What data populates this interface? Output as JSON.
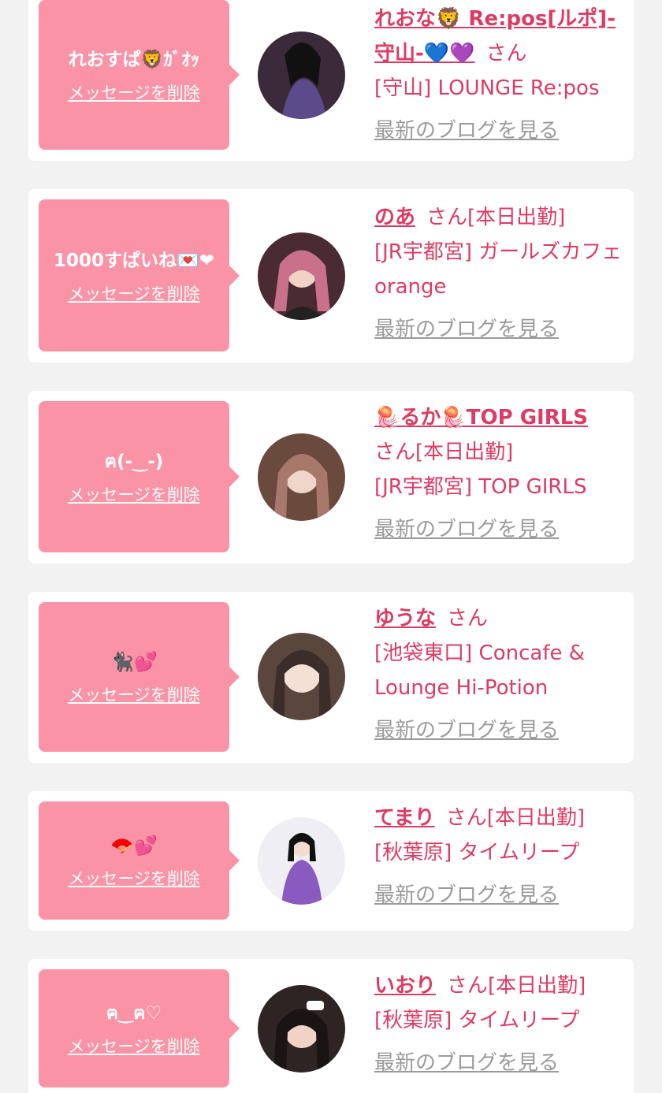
{
  "common": {
    "delete_label": "メッセージを削除",
    "blog_label": "最新のブログを見る",
    "san_suffix": "さん",
    "today_badge": "[本日出勤]"
  },
  "entries": [
    {
      "message": "れおすぱ🦁ｶﾞｵｯ",
      "name": "れおな🦁 Re:pos[ルポ]-守山-💙💜",
      "today": false,
      "shop": "[守山] LOUNGE Re:pos",
      "avatar_color": "#3a2a3a",
      "avatar_accent": "#5b4b8a"
    },
    {
      "message": "1000すぱいね💌❤",
      "name": "のあ",
      "today": true,
      "shop": "[JR宇都宮] ガールズカフェ orange",
      "avatar_color": "#4a2a33",
      "avatar_accent": "#d98a9a"
    },
    {
      "message": "ฅ(-‿-)",
      "name": "🪼るか🪼TOP GIRLS",
      "today": true,
      "shop": "[JR宇都宮] TOP GIRLS",
      "avatar_color": "#6b4a3e",
      "avatar_accent": "#e6c1b0"
    },
    {
      "message": "🐈‍⬛💕",
      "name": "ゆうな",
      "today": false,
      "shop": "[池袋東口] Concafe & Lounge Hi-Potion",
      "avatar_color": "#5a463c",
      "avatar_accent": "#f0d8cc"
    },
    {
      "message": "🪭💕",
      "name": "てまり",
      "today": true,
      "shop": "[秋葉原] タイムリープ",
      "avatar_color": "#efeef4",
      "avatar_accent": "#8a5ac0"
    },
    {
      "message": "ฅ‿ฅ♡",
      "name": "いおり",
      "today": true,
      "shop": "[秋葉原] タイムリープ",
      "avatar_color": "#2e2424",
      "avatar_accent": "#f1d2c4"
    }
  ]
}
